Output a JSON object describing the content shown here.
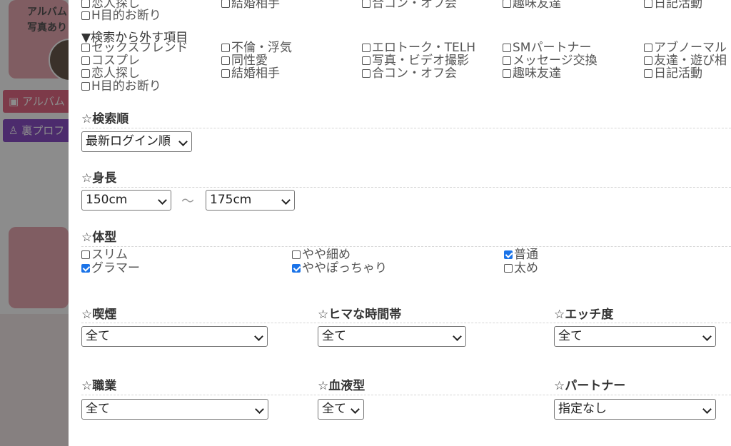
{
  "background": {
    "header_line1": "アルバム",
    "header_line2": "写真あり",
    "album_button": "アルバム",
    "profile_button": "裏プロフ"
  },
  "top_purpose_row1": [
    "恋人探し",
    "結婚相手",
    "合コン・オフ会",
    "趣味友達",
    "日記活動"
  ],
  "top_purpose_row2": "H目的お断り",
  "exclude": {
    "title": "▼検索から外す項目",
    "items": [
      [
        "セックスフレンド",
        "不倫・浮気",
        "エロトーク・TELH",
        "SMパートナー",
        "アブノーマル"
      ],
      [
        "コスプレ",
        "同性愛",
        "写真・ビデオ撮影",
        "メッセージ交換",
        "友達・遊び相"
      ],
      [
        "恋人探し",
        "結婚相手",
        "合コン・オフ会",
        "趣味友達",
        "日記活動"
      ],
      [
        "H目的お断り"
      ]
    ]
  },
  "sort": {
    "heading": "☆検索順",
    "value": "最新ログイン順"
  },
  "height": {
    "heading": "☆身長",
    "min": "150cm",
    "separator": "～",
    "max": "175cm"
  },
  "body_type": {
    "heading": "☆体型",
    "options": [
      {
        "label": "スリム",
        "checked": false
      },
      {
        "label": "やや細め",
        "checked": false
      },
      {
        "label": "普通",
        "checked": true
      },
      {
        "label": "グラマー",
        "checked": true
      },
      {
        "label": "ややぽっちゃり",
        "checked": true
      },
      {
        "label": "太め",
        "checked": false
      }
    ]
  },
  "smoking": {
    "heading": "☆喫煙",
    "value": "全て"
  },
  "free_time": {
    "heading": "☆ヒマな時間帯",
    "value": "全て"
  },
  "h_level": {
    "heading": "☆エッチ度",
    "value": "全て"
  },
  "occupation": {
    "heading": "☆職業",
    "value": "全て"
  },
  "blood_type": {
    "heading": "☆血液型",
    "value": "全て"
  },
  "partner": {
    "heading": "☆パートナー",
    "value": "指定なし"
  },
  "colors": {
    "accent_pink": "#e46b85",
    "accent_purple": "#8a4fc6",
    "checkbox_blue": "#1a73e8"
  }
}
